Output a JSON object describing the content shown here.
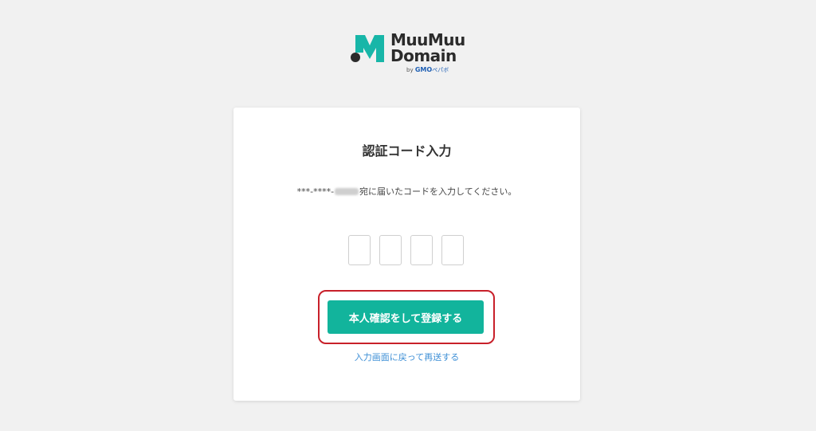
{
  "logo": {
    "line1": "MuuMuu",
    "line2": "Domain",
    "by": "by",
    "gmo": "GMO",
    "pepabo": "ペパボ",
    "mark_color": "#18b6a8",
    "dot_color": "#2b2b2b"
  },
  "card": {
    "title": "認証コード入力",
    "instruction": {
      "masked_prefix": "***-****-",
      "suffix": "宛に届いたコードを入力してください。"
    },
    "code_inputs": [
      "",
      "",
      "",
      ""
    ],
    "submit_label": "本人確認をして登録する",
    "back_link": "入力画面に戻って再送する"
  },
  "colors": {
    "background": "#f1f1f1",
    "accent": "#12b49c",
    "highlight": "#c8202a",
    "link": "#3d8fd6"
  }
}
